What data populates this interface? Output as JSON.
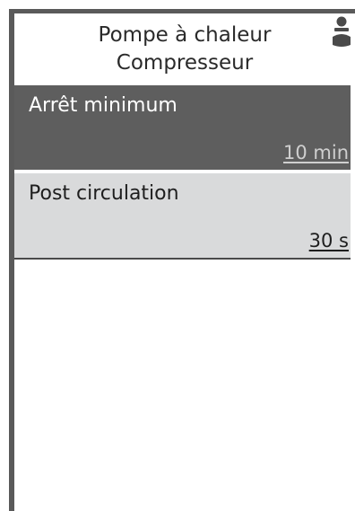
{
  "header": {
    "title_line1": "Pompe à chaleur",
    "title_line2": "Compresseur",
    "user_icon": "user-icon"
  },
  "menu": {
    "items": [
      {
        "label": "Arrêt minimum",
        "value": "10 min",
        "selected": true
      },
      {
        "label": "Post circulation",
        "value": "30 s",
        "selected": false
      }
    ]
  },
  "colors": {
    "frame": "#5a5a5a",
    "selected_bg": "#5e5e5e",
    "item_bg": "#d9dadb",
    "selected_text": "#ffffff"
  }
}
